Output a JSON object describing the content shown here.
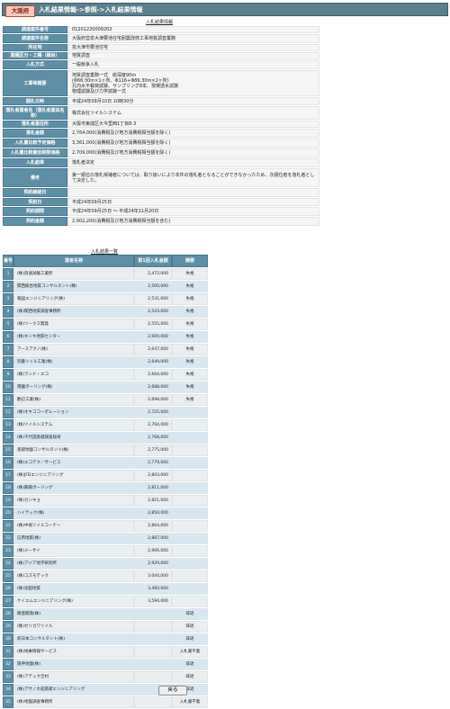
{
  "header": {
    "logo_text": "大阪府",
    "breadcrumb": "入札結果情報->参照->入札結果情報"
  },
  "info": {
    "title": "入札結果情報",
    "rows": [
      {
        "label": "調達案件番号",
        "value": "01201220009202"
      },
      {
        "label": "調達案件名称",
        "value": "大阪府営泉大津要池住宅耐震改修工事地質調査業務"
      },
      {
        "label": "所在地",
        "value": "泉大津市要池住宅"
      },
      {
        "label": "業種区分・工種（細目）",
        "value": "地質調査"
      },
      {
        "label": "入札方式",
        "value": "一般競争入札"
      },
      {
        "label": "工事等概要",
        "value": "地質調査業務一式　総深度90m\n(Φ66:30m×1ヶ所、Φ116+Φ86:30m×2ヶ所)\n孔内水平載荷試験、サンプリング8本、現場透水試験\n物理試験及び力学試験一式"
      },
      {
        "label": "開札日時",
        "value": "平成24年09月10日 10時30分"
      },
      {
        "label": "落札者業者名（落札者業体名称）",
        "value": "株式会社ツイルシステム"
      },
      {
        "label": "落札者業住所",
        "value": "大阪市東成区大今里西1丁目8-3"
      },
      {
        "label": "落札金額",
        "value": "2,764,000(消費税及び地方消費税相当額を除く)"
      },
      {
        "label": "入札書比較予定価格",
        "value": "3,361,000(消費税及び地方消費税相当額を除く)"
      },
      {
        "label": "入札書比較最低制限価格",
        "value": "2,709,000(消費税及び地方消費税相当額を除く)"
      },
      {
        "label": "入札結果",
        "value": "落札者決定"
      },
      {
        "label": "備考",
        "value": "第一順位の落札候補者については、取り扱いにより本件の落札者となることができなかったため、次順位者を落札者として決定した。"
      },
      {
        "label": "契約締結日",
        "value": ""
      },
      {
        "label": "契約日",
        "value": "平成24年09月25日"
      },
      {
        "label": "契約期間",
        "value": "平成24年09月25日 ～ 平成24年11月20日"
      },
      {
        "label": "契約金額",
        "value": "2,902,200(消費税及び地方消費税相当額を含む)"
      }
    ]
  },
  "results": {
    "title": "入札結果一覧",
    "columns": [
      "番号",
      "業者名称",
      "第1回入札金額",
      "摘要"
    ],
    "rows": [
      {
        "no": "1",
        "name": "(株)浪速試験工業所",
        "amount": "2,472,000",
        "remark": "失格"
      },
      {
        "no": "2",
        "name": "関西総合地質コンサルタント(株)",
        "amount": "2,500,000",
        "remark": "失格"
      },
      {
        "no": "3",
        "name": "報国エンジニアリング(株)",
        "amount": "2,531,000",
        "remark": "失格"
      },
      {
        "no": "4",
        "name": "(株)関西地質調査事務所",
        "amount": "2,543,000",
        "remark": "失格"
      },
      {
        "no": "5",
        "name": "(株)ツークス開発",
        "amount": "2,555,000",
        "remark": "失格"
      },
      {
        "no": "6",
        "name": "(株)キンキ地質センター",
        "amount": "2,600,000",
        "remark": "失格"
      },
      {
        "no": "7",
        "name": "アースアクノ(株)",
        "amount": "2,647,000",
        "remark": "失格"
      },
      {
        "no": "8",
        "name": "近畿ソイル工業(株)",
        "amount": "2,649,000",
        "remark": "失格"
      },
      {
        "no": "9",
        "name": "(株)ランド・エコ",
        "amount": "2,664,000",
        "remark": "失格"
      },
      {
        "no": "10",
        "name": "南園ボーリング(株)",
        "amount": "2,688,000",
        "remark": "失格"
      },
      {
        "no": "11",
        "name": "艶辺工業(株)",
        "amount": "2,698,000",
        "remark": "失格"
      },
      {
        "no": "12",
        "name": "(株)オキココーポレーション",
        "amount": "2,725,000",
        "remark": ""
      },
      {
        "no": "13",
        "name": "(株)ツイルシステム",
        "amount": "2,764,000",
        "remark": ""
      },
      {
        "no": "14",
        "name": "(株)千代田基礎調査技術",
        "amount": "2,768,000",
        "remark": ""
      },
      {
        "no": "15",
        "name": "基礎地盤コンサルタンツ(株)",
        "amount": "2,775,000",
        "remark": ""
      },
      {
        "no": "16",
        "name": "(株)エコテク／サービス",
        "amount": "2,779,000",
        "remark": ""
      },
      {
        "no": "17",
        "name": "(株)JFDエンジニアリング",
        "amount": "2,803,000",
        "remark": ""
      },
      {
        "no": "18",
        "name": "(株)興陽ボーリング",
        "amount": "2,811,000",
        "remark": ""
      },
      {
        "no": "19",
        "name": "(株)カンキョ",
        "amount": "2,821,000",
        "remark": ""
      },
      {
        "no": "20",
        "name": "ハイテック(株)",
        "amount": "2,850,000",
        "remark": ""
      },
      {
        "no": "21",
        "name": "(株)中堀ソイルコーナー",
        "amount": "2,864,000",
        "remark": ""
      },
      {
        "no": "22",
        "name": "応用地質(株)",
        "amount": "2,887,000",
        "remark": ""
      },
      {
        "no": "23",
        "name": "(株)メーサイ",
        "amount": "2,906,000",
        "remark": ""
      },
      {
        "no": "24",
        "name": "(株)アジア地学研究所",
        "amount": "2,929,000",
        "remark": ""
      },
      {
        "no": "25",
        "name": "(株)コスモテック",
        "amount": "3,044,000",
        "remark": ""
      },
      {
        "no": "26",
        "name": "(株)池田地質",
        "amount": "3,460,000",
        "remark": ""
      },
      {
        "no": "27",
        "name": "ケイエムエンジニアリング(株)",
        "amount": "3,594,000",
        "remark": ""
      },
      {
        "no": "28",
        "name": "興亜開発(株)",
        "amount": "",
        "remark": "辞退"
      },
      {
        "no": "29",
        "name": "(株)セリカワソイル",
        "amount": "",
        "remark": "辞退"
      },
      {
        "no": "30",
        "name": "新日本コンサルタント(株)",
        "amount": "",
        "remark": "辞退"
      },
      {
        "no": "31",
        "name": "(株)地乗情報サービス",
        "amount": "",
        "remark": "入札書不着"
      },
      {
        "no": "32",
        "name": "阪神地盤(株)",
        "amount": "",
        "remark": "辞退"
      },
      {
        "no": "33",
        "name": "(株)アテック吉村",
        "amount": "",
        "remark": "辞退"
      },
      {
        "no": "34",
        "name": "(株)アサノ大成基礎エンジニアリング",
        "amount": "",
        "remark": "辞退"
      },
      {
        "no": "35",
        "name": "(株)地盤調査事務所",
        "amount": "",
        "remark": "入札書不着"
      }
    ]
  },
  "footer": {
    "back_label": "戻る"
  }
}
